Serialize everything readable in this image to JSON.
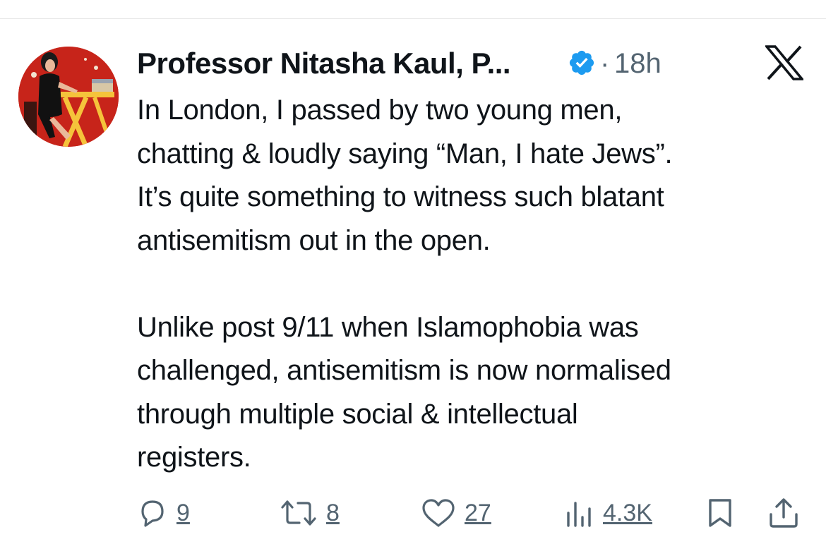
{
  "tweet": {
    "author_name": "Professor Nitasha Kaul, P...",
    "separator": "·",
    "timestamp": "18h",
    "body_lines": [
      "In London, I passed by two  young men,",
      "chatting & loudly saying “Man, I hate Jews”.",
      "It’s quite something to witness such blatant",
      "antisemitism out in the open.",
      "",
      "Unlike post 9/11 when Islamophobia was",
      "challenged, antisemitism is now normalised",
      "through multiple social & intellectual",
      "registers."
    ]
  },
  "actions": {
    "replies": "9",
    "reposts": "8",
    "likes": "27",
    "views": "4.3K"
  },
  "icons": {
    "verified": "verified-badge-icon",
    "platform": "x-logo-icon",
    "reply": "reply-icon",
    "repost": "repost-icon",
    "like": "heart-icon",
    "views": "views-icon",
    "bookmark": "bookmark-icon",
    "share": "share-icon"
  },
  "colors": {
    "verified_blue": "#1d9bf0",
    "text_primary": "#0f1419",
    "text_secondary": "#536471",
    "avatar_background": "#c7241a"
  }
}
